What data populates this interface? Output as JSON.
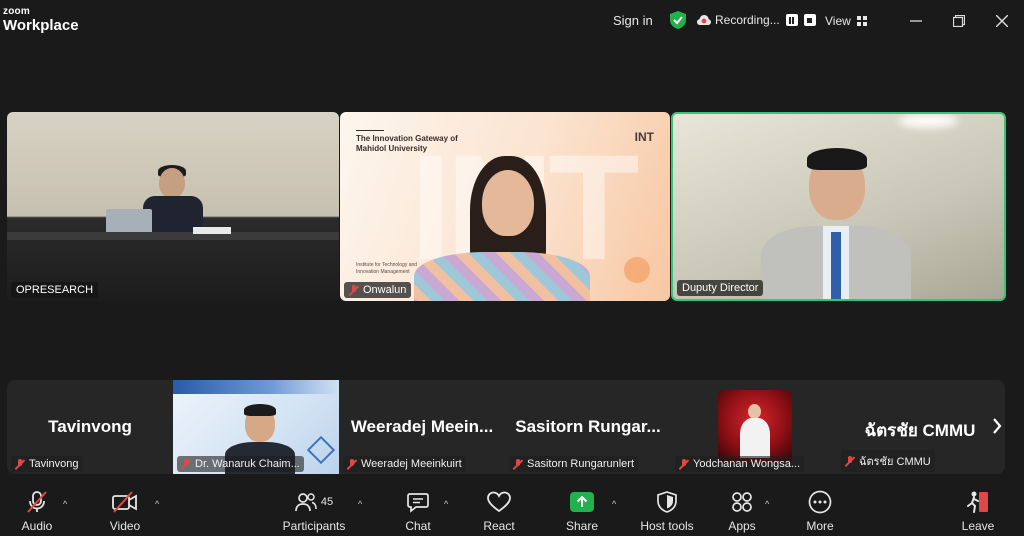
{
  "app": {
    "logo_line1": "zoom",
    "logo_line2": "Workplace"
  },
  "header": {
    "sign_in": "Sign in",
    "recording": "Recording...",
    "view": "View"
  },
  "colors": {
    "active_speaker_border": "#36c47a",
    "share_green": "#22b14c",
    "muted_red": "#e04848"
  },
  "main_tiles": [
    {
      "label": "OPRESEARCH",
      "muted": false
    },
    {
      "label": "Onwalun",
      "muted": true,
      "slide": {
        "title": "The Innovation Gateway of Mahidol University",
        "subtitle": "Institute for Technology and Innovation Management",
        "logo": "INT"
      }
    },
    {
      "label": "Duputy Director",
      "muted": false
    }
  ],
  "gallery": [
    {
      "display_name": "Tavinvong",
      "label": "Tavinvong",
      "has_video": false
    },
    {
      "display_name": "",
      "label": "Dr. Wanaruk Chaim...",
      "has_video": true
    },
    {
      "display_name": "Weeradej  Meein...",
      "label": "Weeradej Meeinkuirt",
      "has_video": false
    },
    {
      "display_name": "Sasitorn  Rungar...",
      "label": "Sasitorn Rungarunlert",
      "has_video": false
    },
    {
      "display_name": "",
      "label": "Yodchanan Wongsa...",
      "has_video": true
    },
    {
      "display_name": "ฉัตรชัย CMMU",
      "label": "ฉัตรชัย CMMU",
      "has_video": false
    }
  ],
  "toolbar": {
    "audio": "Audio",
    "video": "Video",
    "participants": "Participants",
    "participants_count": "45",
    "chat": "Chat",
    "react": "React",
    "share": "Share",
    "host_tools": "Host tools",
    "apps": "Apps",
    "more": "More",
    "leave": "Leave"
  }
}
